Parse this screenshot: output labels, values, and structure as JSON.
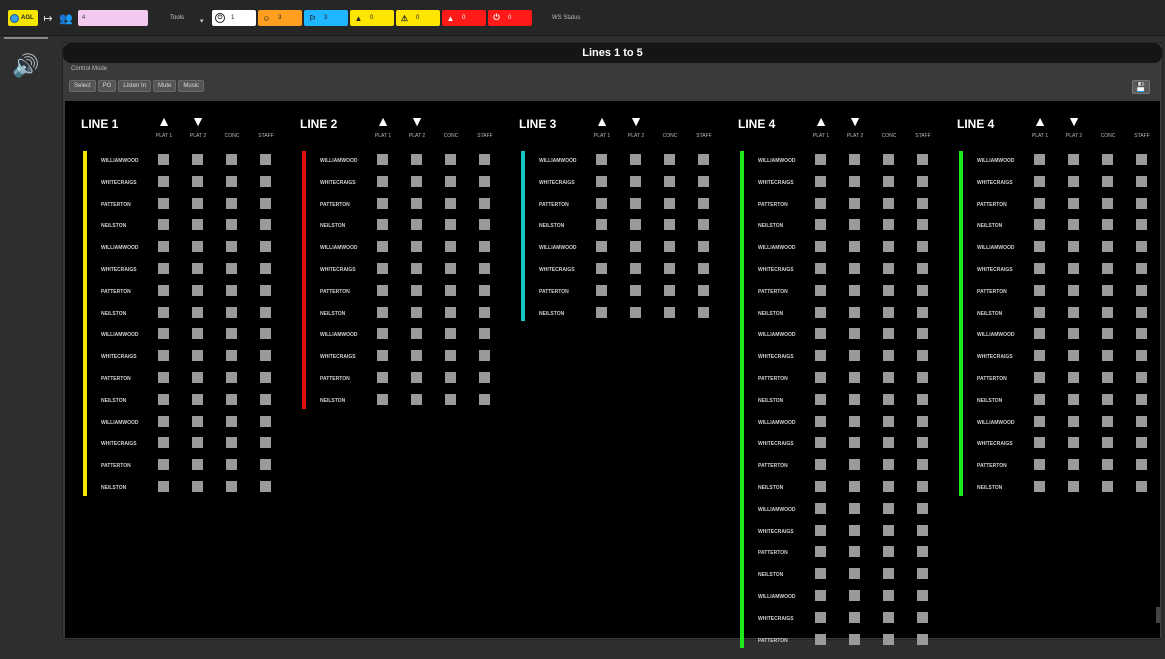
{
  "topbar": {
    "agl_label": "AGL",
    "pink_field_value": "4",
    "tools_label": "Tools",
    "tools_caret": "▾",
    "exit_icon": "↦",
    "user_icon": "👥",
    "counters": [
      {
        "icon": "⏻",
        "count": "1"
      },
      {
        "icon": "☺",
        "count": "3"
      },
      {
        "icon": "⚐",
        "count": "3"
      },
      {
        "icon": "▲",
        "count": "0"
      },
      {
        "icon": "⚠",
        "count": "0"
      },
      {
        "icon": "▲",
        "count": "0"
      },
      {
        "icon": "⏻",
        "count": "0"
      }
    ],
    "ws_status": "WS Status"
  },
  "panel": {
    "title": "Lines 1 to 5",
    "control_mode_label": "Control Mode",
    "buttons": [
      "Select",
      "PG",
      "Listen In",
      "Mute",
      "Music"
    ],
    "save_icon": "💾"
  },
  "column_headers": [
    "PLAT 1",
    "PLAT 2",
    "CONC",
    "STAFF"
  ],
  "lines": [
    {
      "title": "LINE 1",
      "color": "#f5e400",
      "stations": [
        "WILLIAMWOOD",
        "WHITECRAIGS",
        "PATTERTON",
        "NEILSTON",
        "WILLIAMWOOD",
        "WHITECRAIGS",
        "PATTERTON",
        "NEILSTON",
        "WILLIAMWOOD",
        "WHITECRAIGS",
        "PATTERTON",
        "NEILSTON",
        "WILLIAMWOOD",
        "WHITECRAIGS",
        "PATTERTON",
        "NEILSTON"
      ]
    },
    {
      "title": "LINE 2",
      "color": "#e01010",
      "stations": [
        "WILLIAMWOOD",
        "WHITECRAIGS",
        "PATTERTON",
        "NEILSTON",
        "WILLIAMWOOD",
        "WHITECRAIGS",
        "PATTERTON",
        "NEILSTON",
        "WILLIAMWOOD",
        "WHITECRAIGS",
        "PATTERTON",
        "NEILSTON"
      ]
    },
    {
      "title": "LINE 3",
      "color": "#12c8c8",
      "stations": [
        "WILLIAMWOOD",
        "WHITECRAIGS",
        "PATTERTON",
        "NEILSTON",
        "WILLIAMWOOD",
        "WHITECRAIGS",
        "PATTERTON",
        "NEILSTON"
      ]
    },
    {
      "title": "LINE 4",
      "color": "#1ee81e",
      "stations": [
        "WILLIAMWOOD",
        "WHITECRAIGS",
        "PATTERTON",
        "NEILSTON",
        "WILLIAMWOOD",
        "WHITECRAIGS",
        "PATTERTON",
        "NEILSTON",
        "WILLIAMWOOD",
        "WHITECRAIGS",
        "PATTERTON",
        "NEILSTON",
        "WILLIAMWOOD",
        "WHITECRAIGS",
        "PATTERTON",
        "NEILSTON",
        "WILLIAMWOOD",
        "WHITECRAIGS",
        "PATTERTON",
        "NEILSTON",
        "WILLIAMWOOD",
        "WHITECRAIGS",
        "PATTERTON"
      ]
    },
    {
      "title": "LINE 4",
      "color": "#1ee81e",
      "stations": [
        "WILLIAMWOOD",
        "WHITECRAIGS",
        "PATTERTON",
        "NEILSTON",
        "WILLIAMWOOD",
        "WHITECRAIGS",
        "PATTERTON",
        "NEILSTON",
        "WILLIAMWOOD",
        "WHITECRAIGS",
        "PATTERTON",
        "NEILSTON",
        "WILLIAMWOOD",
        "WHITECRAIGS",
        "PATTERTON",
        "NEILSTON"
      ]
    }
  ]
}
